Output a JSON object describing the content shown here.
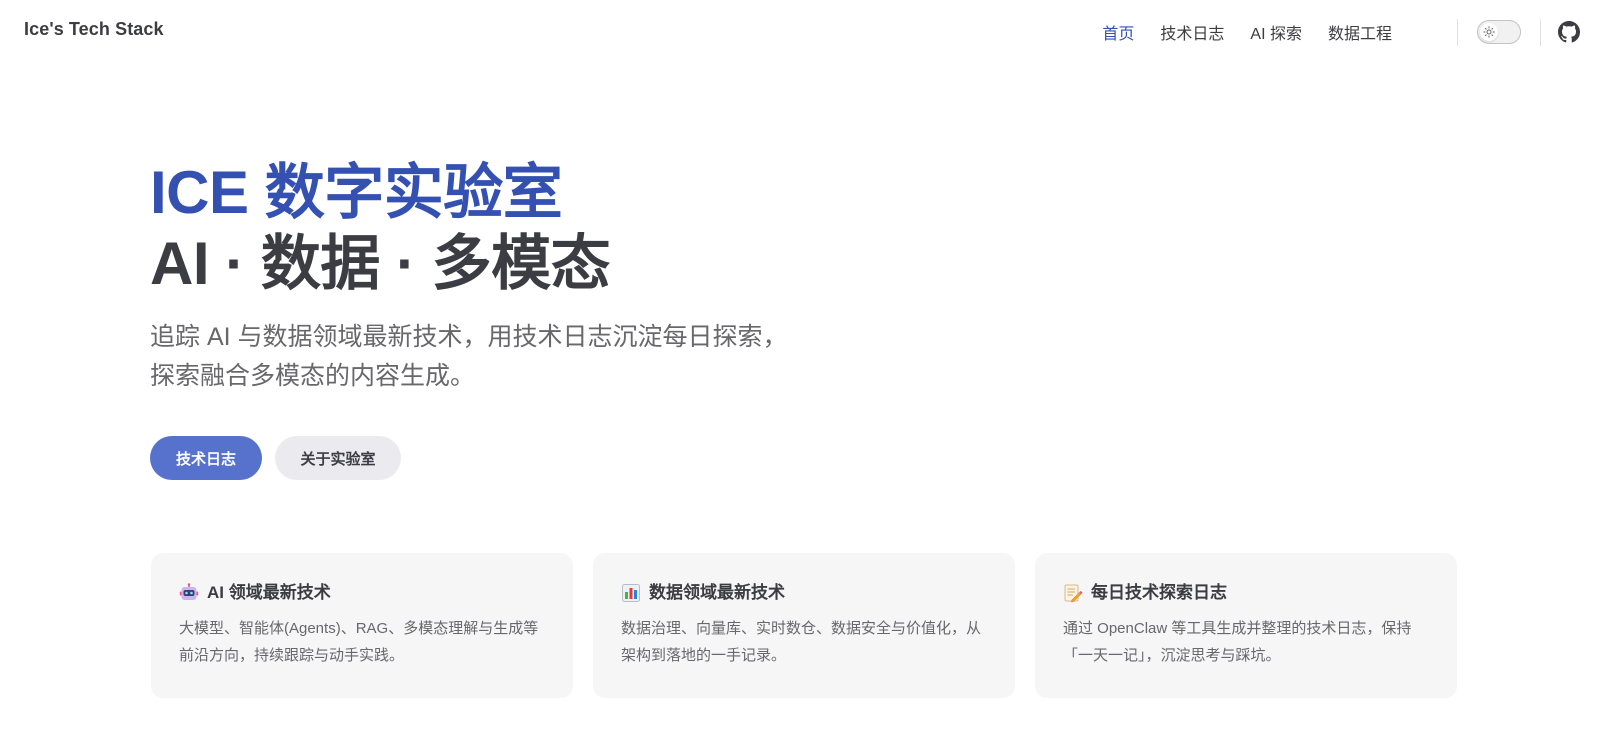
{
  "nav": {
    "brand": "Ice's Tech Stack",
    "links": [
      {
        "label": "首页",
        "active": true
      },
      {
        "label": "技术日志",
        "active": false
      },
      {
        "label": "AI 探索",
        "active": false
      },
      {
        "label": "数据工程",
        "active": false
      }
    ],
    "theme_toggle_icon": "sun-icon",
    "social_icon": "github-icon"
  },
  "hero": {
    "name": "ICE 数字实验室",
    "text": "AI · 数据 · 多模态",
    "tagline": "追踪 AI 与数据领域最新技术，用技术日志沉淀每日探索，探索融合多模态的内容生成。",
    "actions": [
      {
        "label": "技术日志",
        "theme": "brand"
      },
      {
        "label": "关于实验室",
        "theme": "alt"
      }
    ]
  },
  "features": [
    {
      "icon": "robot-icon",
      "title": "AI 领域最新技术",
      "details": "大模型、智能体(Agents)、RAG、多模态理解与生成等前沿方向，持续跟踪与动手实践。"
    },
    {
      "icon": "bar-chart-icon",
      "title": "数据领域最新技术",
      "details": "数据治理、向量库、实时数仓、数据安全与价值化，从架构到落地的一手记录。"
    },
    {
      "icon": "memo-icon",
      "title": "每日技术探索日志",
      "details": "通过 OpenClaw 等工具生成并整理的技术日志，保持「一天一记」，沉淀思考与踩坑。"
    }
  ],
  "colors": {
    "brand": "#3451b2",
    "brand_button": "#5672cd",
    "text": "#3c3c43",
    "muted": "#67676c",
    "feature_bg": "#f6f6f7"
  }
}
